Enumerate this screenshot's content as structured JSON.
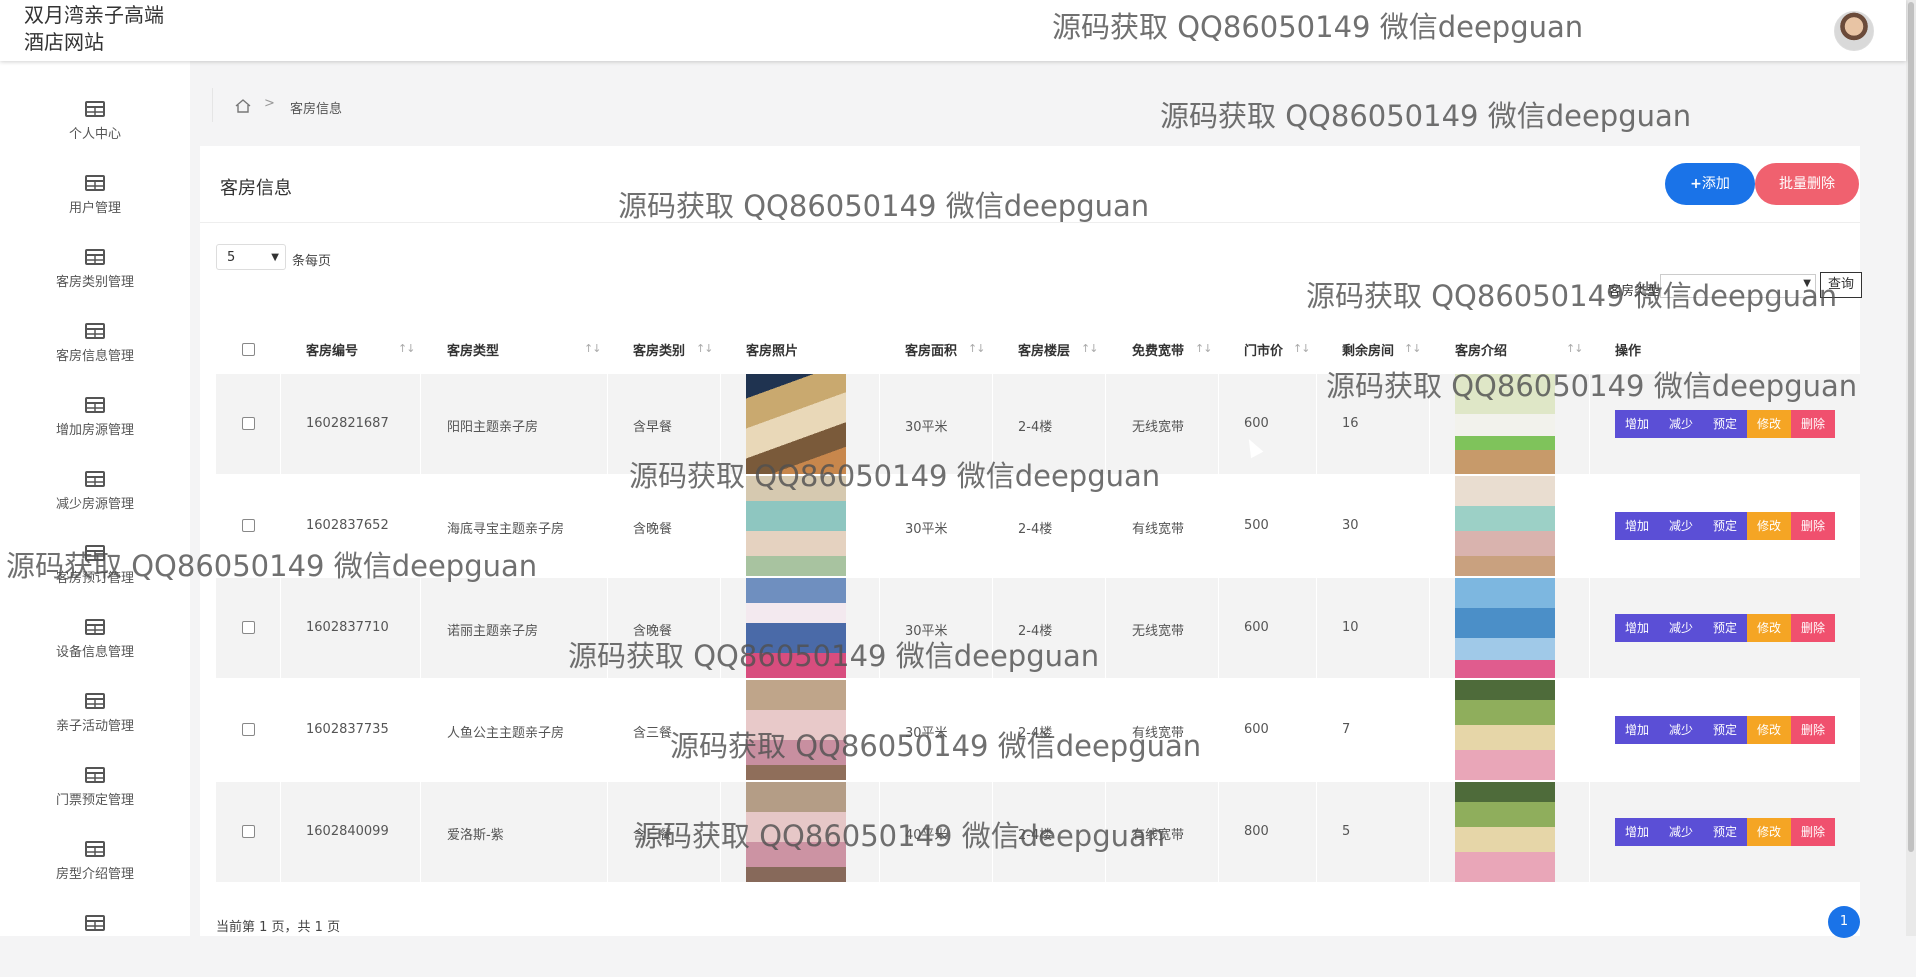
{
  "header": {
    "site_title": "双月湾亲子高端酒店网站"
  },
  "sidebar": {
    "items": [
      {
        "label": "个人中心"
      },
      {
        "label": "用户管理"
      },
      {
        "label": "客房类别管理"
      },
      {
        "label": "客房信息管理"
      },
      {
        "label": "增加房源管理"
      },
      {
        "label": "减少房源管理"
      },
      {
        "label": "客房预订管理"
      },
      {
        "label": "设备信息管理"
      },
      {
        "label": "亲子活动管理"
      },
      {
        "label": "门票预定管理"
      },
      {
        "label": "房型介绍管理"
      }
    ]
  },
  "breadcrumb": {
    "separator": ">",
    "current": "客房信息"
  },
  "panel": {
    "title": "客房信息",
    "add_label": "添加",
    "batch_delete_label": "批量删除",
    "page_size": "5",
    "per_page_label": "条每页",
    "filter_label": "客房类型",
    "query_label": "查询"
  },
  "table": {
    "columns": [
      "客房编号",
      "客房类型",
      "客房类别",
      "客房照片",
      "客房面积",
      "客房楼层",
      "免费宽带",
      "门市价",
      "剩余房间",
      "客房介绍",
      "操作"
    ],
    "rows": [
      {
        "id": "1602821687",
        "type": "阳阳主题亲子房",
        "category": "含早餐",
        "area": "30平米",
        "floor": "2-4楼",
        "broadband": "无线宽带",
        "price": "600",
        "remaining": "16"
      },
      {
        "id": "1602837652",
        "type": "海底寻宝主题亲子房",
        "category": "含晚餐",
        "area": "30平米",
        "floor": "2-4楼",
        "broadband": "有线宽带",
        "price": "500",
        "remaining": "30"
      },
      {
        "id": "1602837710",
        "type": "诺丽主题亲子房",
        "category": "含晚餐",
        "area": "30平米",
        "floor": "2-4楼",
        "broadband": "无线宽带",
        "price": "600",
        "remaining": "10"
      },
      {
        "id": "1602837735",
        "type": "人鱼公主主题亲子房",
        "category": "含三餐",
        "area": "30平米",
        "floor": "2-4楼",
        "broadband": "有线宽带",
        "price": "600",
        "remaining": "7"
      },
      {
        "id": "1602840099",
        "type": "爱洛斯-紫",
        "category": "含三餐",
        "area": "40平米",
        "floor": "2-4楼",
        "broadband": "有线宽带",
        "price": "800",
        "remaining": "5"
      }
    ],
    "actions": [
      "增加",
      "减少",
      "预定",
      "修改",
      "删除"
    ]
  },
  "pagination": {
    "summary": "当前第 1 页，共 1 页",
    "current_page": "1"
  },
  "watermark": "源码获取 QQ86050149 微信deepguan",
  "colors": {
    "primary": "#1a73e8",
    "danger": "#f0616f",
    "op_purple": "#5b4fd6",
    "op_orange": "#f5a524",
    "op_red": "#f0506e"
  }
}
